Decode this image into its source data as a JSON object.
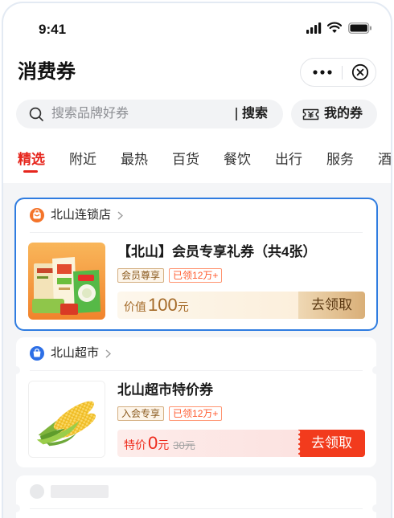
{
  "status_bar": {
    "time": "9:41",
    "icons": [
      "signal-icon",
      "wifi-icon",
      "battery-icon"
    ]
  },
  "header": {
    "title": "消费券",
    "more_icon": "more-icon",
    "close_icon": "close-circle-icon"
  },
  "search": {
    "icon": "search-icon",
    "placeholder": "搜索品牌好券",
    "button_label": "搜索"
  },
  "my_coupons": {
    "icon": "coupon-ticket-icon",
    "label": "我的券"
  },
  "tabs": [
    {
      "label": "精选",
      "active": true
    },
    {
      "label": "附近",
      "active": false
    },
    {
      "label": "最热",
      "active": false
    },
    {
      "label": "百货",
      "active": false
    },
    {
      "label": "餐饮",
      "active": false
    },
    {
      "label": "出行",
      "active": false
    },
    {
      "label": "服务",
      "active": false
    },
    {
      "label": "酒",
      "active": false
    }
  ],
  "coupons": [
    {
      "store": {
        "name": "北山连锁店",
        "icon": "store-icon"
      },
      "title": "【北山】会员专享礼券（共4张）",
      "tags": [
        "会员尊享",
        "已领12万+"
      ],
      "price": {
        "prefix": "价值",
        "value": "100",
        "unit": "元"
      },
      "cta": "去领取",
      "selected": true
    },
    {
      "store": {
        "name": "北山超市",
        "icon": "shopping-bag-icon"
      },
      "title": "北山超市特价券",
      "tags": [
        "入会专享",
        "已领12万+"
      ],
      "price": {
        "prefix": "特价",
        "value": "0",
        "unit": "元",
        "original": "30元"
      },
      "cta": "去领取",
      "selected": false
    }
  ],
  "colors": {
    "accent_red": "#e6261d",
    "selection_blue": "#2f7ce0",
    "gold_button": "#d9af78",
    "red_button": "#f23b1d",
    "feed_background": "#f4f5f7"
  }
}
